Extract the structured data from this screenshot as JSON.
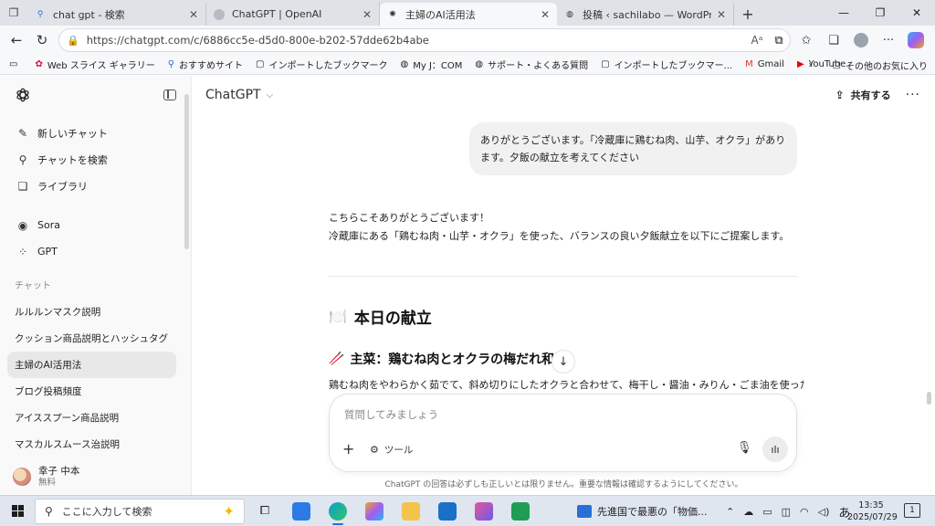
{
  "browser": {
    "tabs": [
      {
        "title": "chat gpt - 検索",
        "icon": "search-icon"
      },
      {
        "title": "ChatGPT | OpenAI",
        "icon": "circle-icon"
      },
      {
        "title": "主婦のAI活用法",
        "icon": "openai-icon"
      },
      {
        "title": "投稿 ‹ sachilabo — WordPress",
        "icon": "globe-icon"
      }
    ],
    "url": "https://chatgpt.com/c/6886cc5e-d5d0-800e-b202-57dde62b4abe",
    "bookmarks": [
      "Web スライス ギャラリー",
      "おすすめサイト",
      "インポートしたブックマーク",
      "My J：COM",
      "サポート・よくある質問",
      "インポートしたブックマー...",
      "Gmail",
      "YouTube"
    ],
    "other_favorites": "その他のお気に入り"
  },
  "sidebar": {
    "primary": [
      {
        "label": "新しいチャット",
        "icon": "new-chat-icon"
      },
      {
        "label": "チャットを検索",
        "icon": "search-icon"
      },
      {
        "label": "ライブラリ",
        "icon": "library-icon"
      }
    ],
    "secondary": [
      {
        "label": "Sora",
        "icon": "play-icon"
      },
      {
        "label": "GPT",
        "icon": "grid-icon"
      }
    ],
    "history_label": "チャット",
    "history": [
      "ルルルンマスク説明",
      "クッション商品説明とハッシュタグ",
      "主婦のAI活用法",
      "ブログ投稿頻度",
      "アイススプーン商品説明",
      "マスカルスムース治説明"
    ],
    "user": {
      "name": "幸子 中本",
      "plan": "無料"
    }
  },
  "main": {
    "model": "ChatGPT",
    "share": "共有する",
    "user_message": "ありがとうございます。「冷蔵庫に鶏むね肉、山芋、オクラ」があります。夕飯の献立を考えてください",
    "reply_line1": "こちらこそありがとうございます！",
    "reply_line2": "冷蔵庫にある「鶏むね肉・山芋・オクラ」を使った、バランスの良い夕飯献立を以下にご提案します。",
    "heading": "本日の献立",
    "heading_emoji": "🍽️",
    "subheading": "主菜：鶏むね肉とオクラの梅だれ和え",
    "subheading_emoji": "🥢",
    "paragraph": "鶏むね肉をやわらかく茹でて、斜め切りにしたオクラと合わせて、梅干し・醤油・みりん・ごま油を使ったさっぱり",
    "composer_placeholder": "質問してみましょう",
    "tools_label": "ツール",
    "disclaimer": "ChatGPT の回答は必ずしも正しいとは限りません。重要な情報は確認するようにしてください。"
  },
  "taskbar": {
    "search_placeholder": "ここに入力して検索",
    "news": "先進国で最悪の「物価...",
    "ime": "あ",
    "time": "13:35",
    "date": "2025/07/29",
    "notification_count": "1"
  }
}
